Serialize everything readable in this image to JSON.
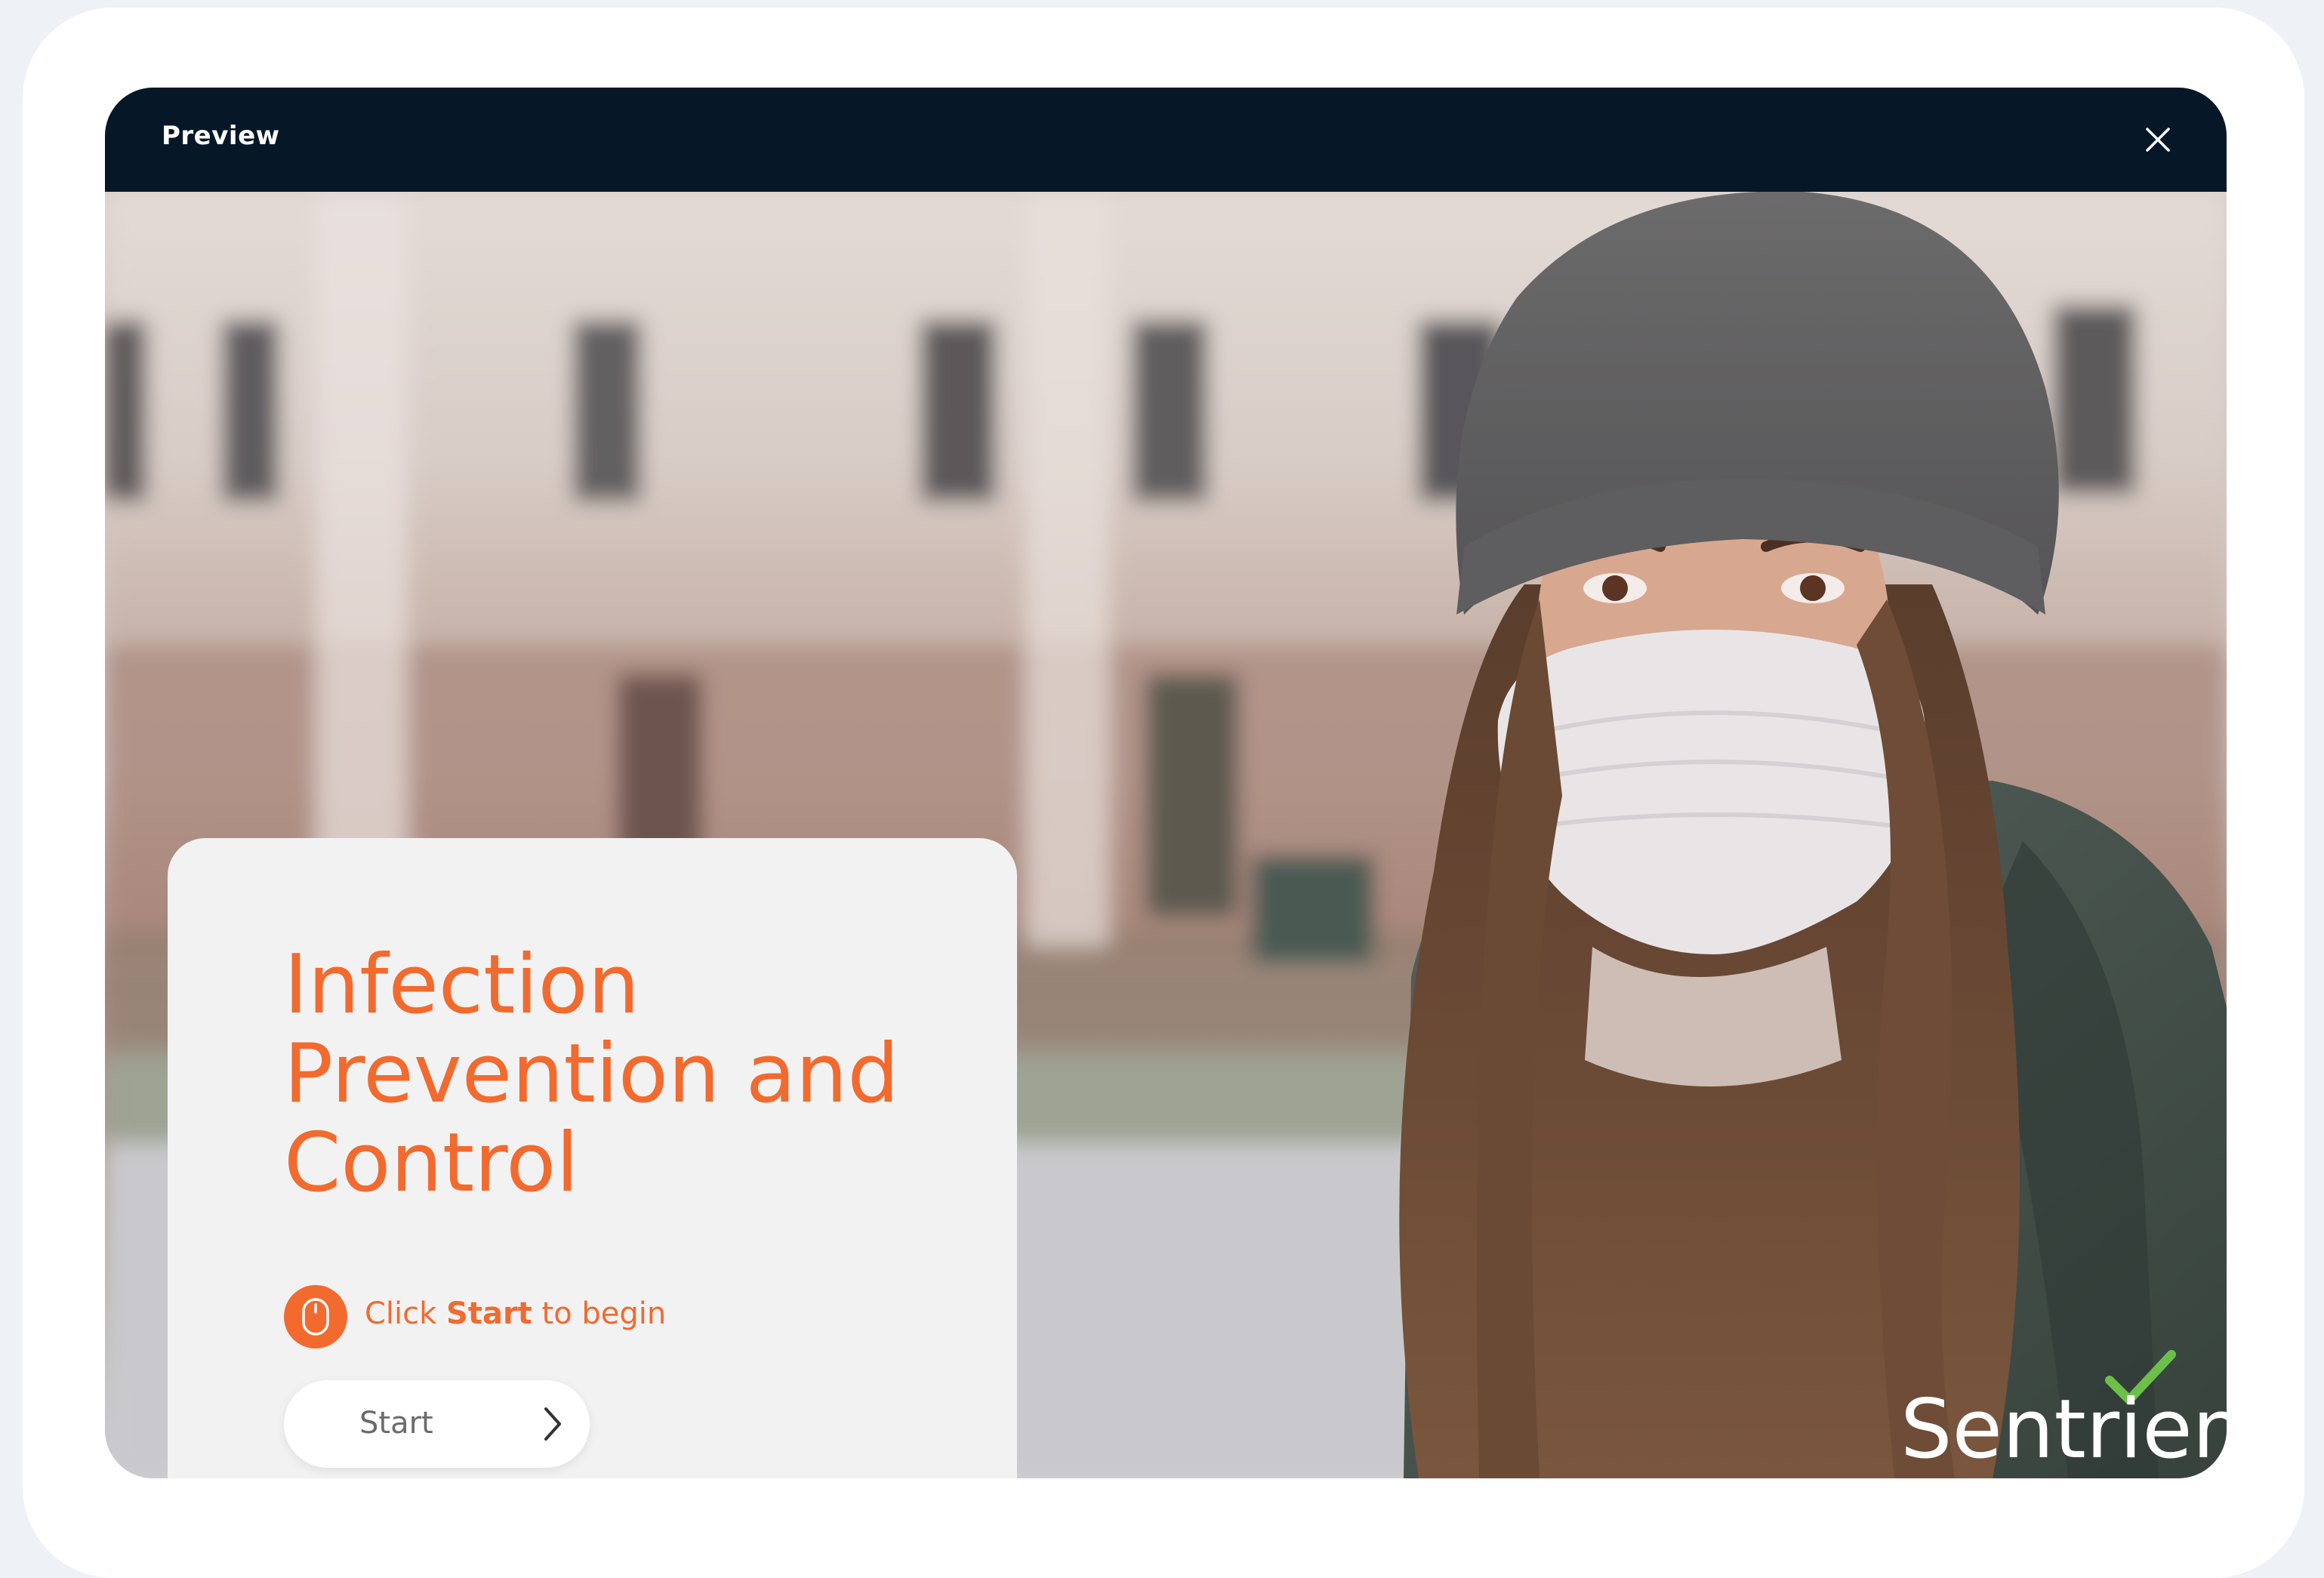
{
  "window": {
    "title": "Preview",
    "close_icon": "close-icon"
  },
  "course": {
    "title": "Infection Prevention and Control",
    "instruction_prefix": "Click",
    "instruction_keyword": "Start",
    "instruction_suffix": "to begin",
    "instruction_icon": "mouse-icon",
    "start_label": "Start",
    "start_icon": "chevron-right-icon"
  },
  "brand": {
    "name": "Sentrient",
    "mark_icon": "checkmark-icon"
  },
  "colors": {
    "titlebar": "#061828",
    "accent": "#f26a2e",
    "panel": "#f2f2f3",
    "brand_check": "#6cc04a"
  }
}
